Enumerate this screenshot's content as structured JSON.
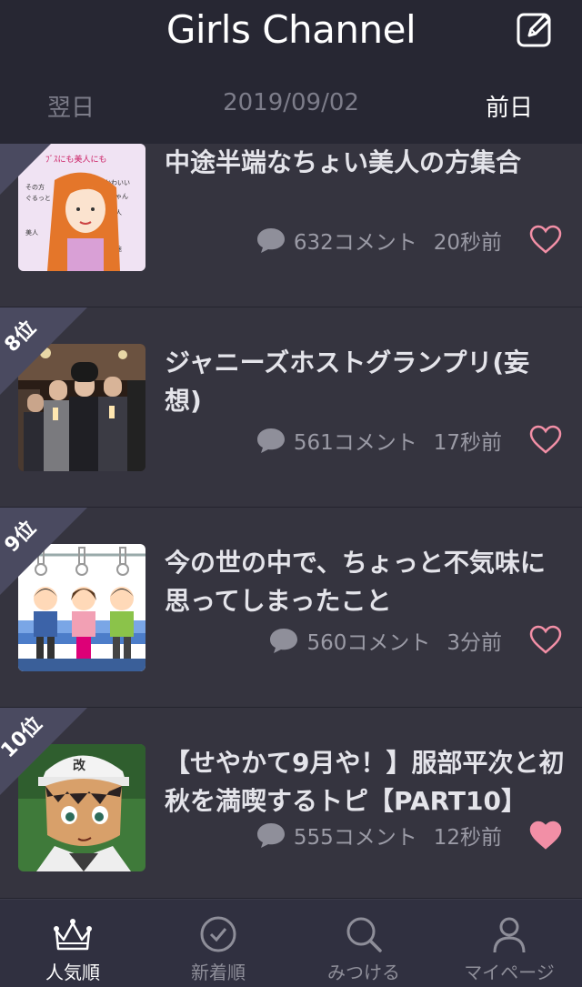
{
  "app": {
    "title": "Girls Channel"
  },
  "datebar": {
    "prev_label": "翌日",
    "date": "2019/09/02",
    "next_label": "前日"
  },
  "topics": [
    {
      "rank_label": "",
      "title": "中途半端なちょい美人の方集合",
      "comments": "632コメント",
      "time": "20秒前",
      "liked": false
    },
    {
      "rank_label": "8位",
      "title": "ジャニーズホストグランプリ(妄想)",
      "comments": "561コメント",
      "time": "17秒前",
      "liked": false
    },
    {
      "rank_label": "9位",
      "title": "今の世の中で、ちょっと不気味に思ってしまったこと",
      "comments": "560コメント",
      "time": "3分前",
      "liked": false
    },
    {
      "rank_label": "10位",
      "title": "【せやかて9月や！】服部平次と初秋を満喫するトピ【PART10】",
      "comments": "555コメント",
      "time": "12秒前",
      "liked": true
    }
  ],
  "tabs": [
    {
      "label": "人気順",
      "icon": "crown-icon",
      "active": true
    },
    {
      "label": "新着順",
      "icon": "clock-icon",
      "active": false
    },
    {
      "label": "みつける",
      "icon": "search-icon",
      "active": false
    },
    {
      "label": "マイページ",
      "icon": "person-icon",
      "active": false
    }
  ],
  "colors": {
    "heart": "#f28fa6",
    "background": "#2a2a36",
    "card": "#35343f",
    "rank_badge": "#4a4a60"
  }
}
